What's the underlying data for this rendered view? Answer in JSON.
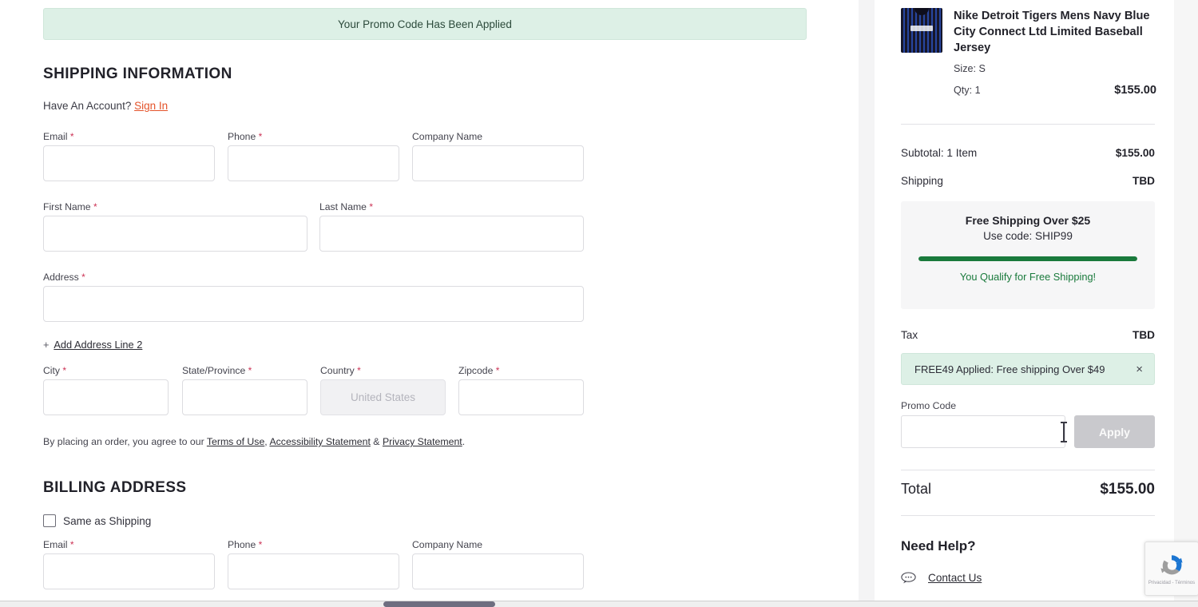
{
  "banner": {
    "message": "Your Promo Code Has Been Applied"
  },
  "shipping": {
    "title": "SHIPPING INFORMATION",
    "account_prompt": "Have An Account?",
    "sign_in_label": "Sign In",
    "fields": {
      "email": {
        "label": "Email",
        "required_mark": "*",
        "value": "",
        "placeholder": ""
      },
      "phone": {
        "label": "Phone",
        "required_mark": "*",
        "value": "",
        "placeholder": ""
      },
      "company": {
        "label": "Company Name",
        "required_mark": "",
        "value": "",
        "placeholder": ""
      },
      "first_name": {
        "label": "First Name",
        "required_mark": "*",
        "value": "",
        "placeholder": ""
      },
      "last_name": {
        "label": "Last Name",
        "required_mark": "*",
        "value": "",
        "placeholder": ""
      },
      "address": {
        "label": "Address",
        "required_mark": "*",
        "value": "",
        "placeholder": ""
      },
      "city": {
        "label": "City",
        "required_mark": "*",
        "value": "",
        "placeholder": ""
      },
      "state": {
        "label": "State/Province",
        "required_mark": "*",
        "value": "",
        "placeholder": ""
      },
      "country": {
        "label": "Country",
        "required_mark": "*",
        "value": "",
        "placeholder": "United States"
      },
      "zipcode": {
        "label": "Zipcode",
        "required_mark": "*",
        "value": "",
        "placeholder": ""
      }
    },
    "add_address_line2": "Add Address Line 2",
    "add_address_plus": "+",
    "terms": {
      "prefix": "By placing an order, you agree to our ",
      "link1": "Terms of Use",
      "sep1": ", ",
      "link2": "Accessibility Statement",
      "sep2": " & ",
      "link3": "Privacy Statement",
      "suffix": "."
    }
  },
  "billing": {
    "title": "BILLING ADDRESS",
    "same_as_shipping_label": "Same as Shipping",
    "same_as_shipping_checked": false,
    "fields": {
      "email": {
        "label": "Email",
        "required_mark": "*",
        "value": "",
        "placeholder": ""
      },
      "phone": {
        "label": "Phone",
        "required_mark": "*",
        "value": "",
        "placeholder": ""
      },
      "company": {
        "label": "Company Name",
        "required_mark": "",
        "value": "",
        "placeholder": ""
      }
    }
  },
  "summary": {
    "product": {
      "name": "Nike Detroit Tigers Mens Navy Blue City Connect Ltd Limited Baseball Jersey",
      "size_label": "Size:",
      "size_value": "S",
      "qty_label": "Qty:",
      "qty_value": "1",
      "price": "$155.00"
    },
    "subtotal_label": "Subtotal: 1 Item",
    "subtotal_value": "$155.00",
    "shipping_label": "Shipping",
    "shipping_value": "TBD",
    "free_shipping": {
      "title": "Free Shipping Over $25",
      "code_text": "Use code: SHIP99",
      "progress_percent": 100,
      "qualify_message": "You Qualify for Free Shipping!",
      "bar_color": "#1a7a3c"
    },
    "tax_label": "Tax",
    "tax_value": "TBD",
    "applied_promo": {
      "text": "FREE49 Applied: Free shipping Over $49",
      "dismiss_icon": "×"
    },
    "promo_code_label": "Promo Code",
    "promo_code_value": "",
    "promo_code_placeholder": "",
    "apply_button_label": "Apply",
    "total_label": "Total",
    "total_value": "$155.00"
  },
  "help": {
    "title": "Need Help?",
    "contact_label": "Contact Us"
  },
  "recaptcha": {
    "text": "Privacidad - Términos"
  }
}
